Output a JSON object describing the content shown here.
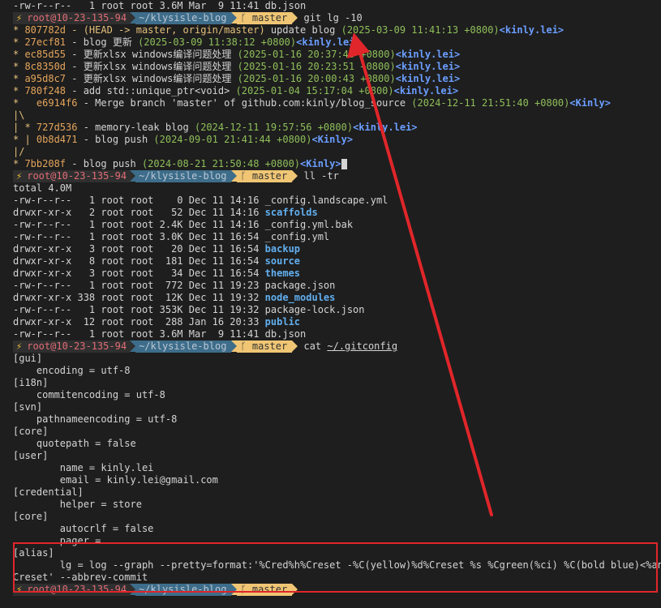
{
  "prompt": {
    "bolt": "⚡",
    "host": "root@10-23-135-94",
    "dir": "~/klysisle-blog",
    "branch_icon": "ᚴ",
    "branch": "master"
  },
  "lines": {
    "l0": "-rw-r--r--   1 root root 3.6M Mar  9 11:41 db.json",
    "cmd1": "git lg -10",
    "g1": {
      "graph": "* ",
      "hash": "807782d",
      "refs": " - (HEAD -> master, origin/master)",
      "msg": " update blog ",
      "date": "(2025-03-09 11:41:13 +0800)",
      "auth": "<kinly.lei>"
    },
    "g2": {
      "graph": "* ",
      "hash": "27ecf81",
      "msg": " - blog 更新 ",
      "date": "(2025-03-09 11:38:12 +0800)",
      "auth": "<kinly.lei>"
    },
    "g3": {
      "graph": "* ",
      "hash": "ec85d55",
      "msg": " - 更新xlsx windows编译问题处理 ",
      "date": "(2025-01-16 20:37:48 +0800)",
      "auth": "<kinly.lei>"
    },
    "g4": {
      "graph": "* ",
      "hash": "8c8350d",
      "msg": " - 更新xlsx windows编译问题处理 ",
      "date": "(2025-01-16 20:23:51 +0800)",
      "auth": "<kinly.lei>"
    },
    "g5": {
      "graph": "* ",
      "hash": "a95d8c7",
      "msg": " - 更新xlsx windows编译问题处理 ",
      "date": "(2025-01-16 20:00:43 +0800)",
      "auth": "<kinly.lei>"
    },
    "g6": {
      "graph": "* ",
      "hash": "780f248",
      "msg": " - add std::unique_ptr<void> ",
      "date": "(2025-01-04 15:17:04 +0800)",
      "auth": "<kinly.lei>"
    },
    "g7": {
      "graph": "*   ",
      "hash": "e6914f6",
      "msg": " - Merge branch 'master' of github.com:kinly/blog_source ",
      "date": "(2024-12-11 21:51:40 +0800)",
      "auth": "<Kinly>"
    },
    "g8": {
      "graph": "|\\"
    },
    "g9": {
      "graph": "| * ",
      "hash": "727d536",
      "msg": " - memory-leak blog ",
      "date": "(2024-12-11 19:57:56 +0800)",
      "auth": "<kinly.lei>"
    },
    "g10": {
      "graph": "* | ",
      "hash": "0b8d471",
      "msg": " - blog push ",
      "date": "(2024-09-01 21:41:44 +0800)",
      "auth": "<Kinly>"
    },
    "g11": {
      "graph": "|/"
    },
    "g12": {
      "graph": "* ",
      "hash": "7bb208f",
      "msg": " - blog push ",
      "date": "(2024-08-21 21:50:48 +0800)",
      "auth": "<Kinly>"
    },
    "cmd2": "ll -tr",
    "total": "total 4.0M",
    "ls": [
      {
        "meta": "-rw-r--r--   1 root root    0 Dec 11 14:16 ",
        "name": "_config.landscape.yml",
        "dir": false
      },
      {
        "meta": "drwxr-xr-x   2 root root   52 Dec 11 14:16 ",
        "name": "scaffolds",
        "dir": true
      },
      {
        "meta": "-rw-r--r--   1 root root 2.4K Dec 11 14:16 ",
        "name": "_config.yml.bak",
        "dir": false
      },
      {
        "meta": "-rw-r--r--   1 root root 3.0K Dec 11 16:54 ",
        "name": "_config.yml",
        "dir": false
      },
      {
        "meta": "drwxr-xr-x   3 root root   20 Dec 11 16:54 ",
        "name": "backup",
        "dir": true
      },
      {
        "meta": "drwxr-xr-x   8 root root  181 Dec 11 16:54 ",
        "name": "source",
        "dir": true
      },
      {
        "meta": "drwxr-xr-x   3 root root   34 Dec 11 16:54 ",
        "name": "themes",
        "dir": true
      },
      {
        "meta": "-rw-r--r--   1 root root  772 Dec 11 19:23 ",
        "name": "package.json",
        "dir": false
      },
      {
        "meta": "drwxr-xr-x 338 root root  12K Dec 11 19:32 ",
        "name": "node_modules",
        "dir": true
      },
      {
        "meta": "-rw-r--r--   1 root root 353K Dec 11 19:32 ",
        "name": "package-lock.json",
        "dir": false
      },
      {
        "meta": "drwxr-xr-x  12 root root  288 Jan 16 20:33 ",
        "name": "public",
        "dir": true
      },
      {
        "meta": "-rw-r--r--   1 root root 3.6M Mar  9 11:41 ",
        "name": "db.json",
        "dir": false
      }
    ],
    "cmd3": "cat ",
    "cmd3_arg": "~/.gitconfig",
    "cfg": [
      "[gui]",
      "    encoding = utf-8",
      "[i18n]",
      "    commitencoding = utf-8",
      "[svn]",
      "    pathnameencoding = utf-8",
      "[core]",
      "    quotepath = false",
      "[user]",
      "        name = kinly.lei",
      "        email = kinly.lei@gmail.com",
      "[credential]",
      "        helper = store",
      "[core]",
      "        autocrlf = false",
      "        pager =",
      "[alias]",
      "        lg = log --graph --pretty=format:'%Cred%h%Creset -%C(yellow)%d%Creset %s %Cgreen(%ci) %C(bold blue)<%an>%",
      "Creset' --abbrev-commit"
    ]
  },
  "colors": {
    "background": "#1e1e1e",
    "annotation_red": "#e0262a"
  }
}
